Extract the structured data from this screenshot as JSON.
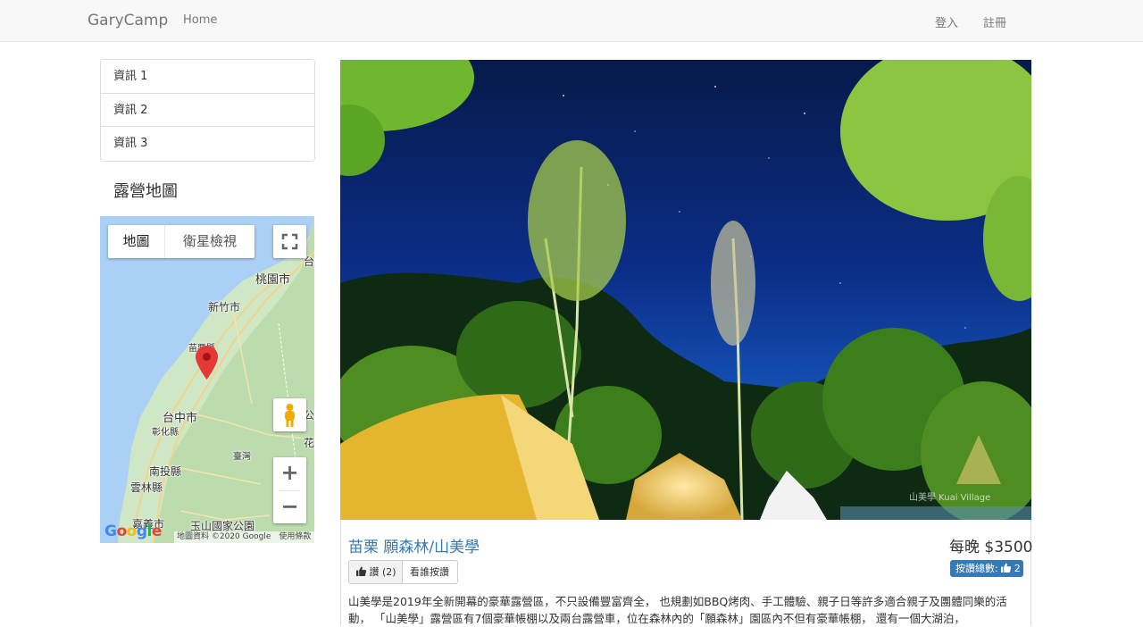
{
  "navbar": {
    "brand": "GaryCamp",
    "home": "Home",
    "login": "登入",
    "register": "註冊"
  },
  "sidebar": {
    "items": [
      {
        "label": "資訊 1"
      },
      {
        "label": "資訊 2"
      },
      {
        "label": "資訊 3"
      }
    ],
    "map_title": "露營地圖"
  },
  "map": {
    "type_map": "地圖",
    "type_satellite": "衛星檢視",
    "labels": {
      "taoyuan": "桃園市",
      "hsinchu": "新竹市",
      "miaoli": "苗栗縣",
      "taichung": "台中市",
      "changhua": "彰化縣",
      "nantou": "南投縣",
      "yunlin": "雲林縣",
      "chiayi": "嘉義市",
      "yushan": "玉山國家公園",
      "taiwan": "臺灣",
      "hualien": "花",
      "tai": "台",
      "gong": "公"
    },
    "zoom_in": "+",
    "zoom_out": "−",
    "attribution": "地圖資料 ©2020 Google　使用條款",
    "logo": "Google",
    "logo_colors": [
      "#4285f4",
      "#ea4335",
      "#fbbc05",
      "#4285f4",
      "#34a853",
      "#ea4335"
    ]
  },
  "campsite": {
    "title": "苗栗 願森林/山美學",
    "price": "每晚 $3500",
    "like_button": "讚 (2)",
    "who_liked_button": "看誰按讚",
    "total_likes_label": "按讚總數:",
    "total_likes_count": "2",
    "photo_watermark": "山美學 Kuai Village",
    "description": "山美學是2019年全新開幕的豪華露營區，不只設備豐富齊全， 也規劃如BBQ烤肉、手工體驗、親子日等許多適合親子及團體同樂的活動， 「山美學」露營區有7個豪華帳棚以及兩台露營車，位在森林內的「願森林」園區內不但有豪華帳棚， 還有一個大湖泊，"
  },
  "colors": {
    "link": "#337ab7",
    "badge": "#337ab7",
    "marker": "#e53935"
  }
}
